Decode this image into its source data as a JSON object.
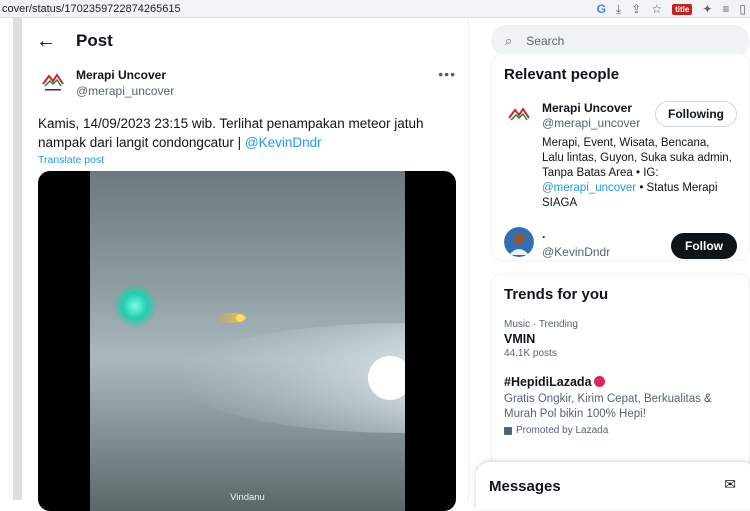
{
  "browser": {
    "url": "cover/status/1702359722874265615"
  },
  "header": {
    "title": "Post"
  },
  "tweet": {
    "author_name": "Merapi Uncover",
    "author_handle": "@merapi_uncover",
    "text": "Kamis, 14/09/2023 23:15 wib. Terlihat penampakan meteor jatuh nampak dari langit condongcatur | ",
    "mention": "@KevinDndr",
    "translate_label": "Translate post",
    "video_watermark": "Vindanu"
  },
  "search": {
    "placeholder": "Search"
  },
  "relevant_people": {
    "title": "Relevant people",
    "people": [
      {
        "name": "Merapi Uncover",
        "handle": "@merapi_uncover",
        "bio_prefix": "Merapi, Event, Wisata, Bencana, Lalu lintas, Guyon, Suka suka admin, Tanpa Batas Area • IG: ",
        "bio_link": "@merapi_uncover",
        "bio_suffix": " • Status Merapi SIAGA",
        "button": "Following"
      },
      {
        "name": ".",
        "handle": "@KevinDndr",
        "button": "Follow"
      }
    ]
  },
  "trends": {
    "title": "Trends for you",
    "items": [
      {
        "meta": "Music · Trending",
        "name": "VMIN",
        "count": "44.1K posts"
      },
      {
        "name": "#HepidiLazada",
        "description": "Gratis Ongkir, Kirim Cepat, Berkualitas & Murah Pol bikin 100% Hepi!",
        "promoted": "Promoted by Lazada"
      }
    ]
  },
  "messages": {
    "label": "Messages"
  },
  "colors": {
    "accent": "#1d9bf0",
    "follow_button": "#0f1419"
  }
}
